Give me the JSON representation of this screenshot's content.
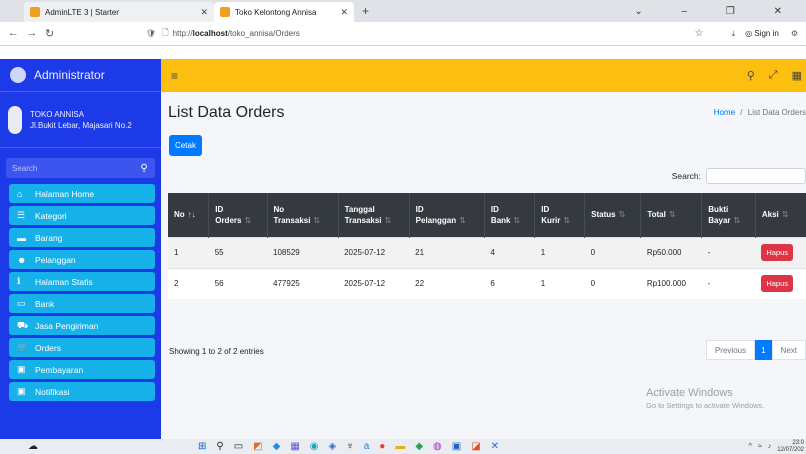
{
  "browser": {
    "tabs": [
      {
        "title": "AdminLTE 3 | Starter"
      },
      {
        "title": "Toko Kelontong Annisa"
      }
    ],
    "url_prefix": "http://",
    "url_host": "localhost",
    "url_path": "/toko_annisa/Orders",
    "sign_in": "Sign in"
  },
  "sidebar": {
    "brand": "Administrator",
    "store_name": "TOKO ANNISA",
    "store_address": "Jl.Bukit Lebar, Majasari No.2",
    "search_placeholder": "Search",
    "items": [
      {
        "label": "Halaman Home",
        "icon": "home-icon",
        "glyph": "⌂"
      },
      {
        "label": "Kategori",
        "icon": "list-icon",
        "glyph": "☰"
      },
      {
        "label": "Barang",
        "icon": "box-icon",
        "glyph": "▬"
      },
      {
        "label": "Pelanggan",
        "icon": "users-icon",
        "glyph": "☻"
      },
      {
        "label": "Halaman Statis",
        "icon": "info-icon",
        "glyph": "ℹ"
      },
      {
        "label": "Bank",
        "icon": "bank-card-icon",
        "glyph": "▭"
      },
      {
        "label": "Jasa Pengiriman",
        "icon": "truck-icon",
        "glyph": "⛟"
      },
      {
        "label": "Orders",
        "icon": "cart-icon",
        "glyph": "🛒"
      },
      {
        "label": "Pembayaran",
        "icon": "money-icon",
        "glyph": "▣"
      },
      {
        "label": "Notifikasi",
        "icon": "bell-icon",
        "glyph": "▣"
      }
    ]
  },
  "page": {
    "title": "List Data Orders",
    "breadcrumb_home": "Home",
    "breadcrumb_sep": "/",
    "breadcrumb_current": "List Data Orders",
    "cetak_label": "Cetak",
    "search_label": "Search:"
  },
  "table": {
    "headers": [
      [
        "No",
        ""
      ],
      [
        "ID",
        "Orders"
      ],
      [
        "No",
        "Transaksi"
      ],
      [
        "Tanggal",
        "Transaksi"
      ],
      [
        "ID",
        "Pelanggan"
      ],
      [
        "ID",
        "Bank"
      ],
      [
        "ID",
        "Kurir"
      ],
      [
        "Status",
        ""
      ],
      [
        "Total",
        ""
      ],
      [
        "Bukti",
        "Bayar"
      ],
      [
        "Aksi",
        ""
      ]
    ],
    "rows": [
      [
        "1",
        "55",
        "108529",
        "2025-07-12",
        "21",
        "4",
        "1",
        "0",
        "Rp50.000",
        "-",
        "Hapus"
      ],
      [
        "2",
        "56",
        "477925",
        "2025-07-12",
        "22",
        "6",
        "1",
        "0",
        "Rp100.000",
        "-",
        "Hapus"
      ]
    ],
    "info": "Showing 1 to 2 of 2 entries",
    "pager": {
      "previous": "Previous",
      "current": "1",
      "next": "Next"
    }
  },
  "watermark": {
    "title": "Activate Windows",
    "subtitle": "Go to Settings to activate Windows."
  },
  "taskbar": {
    "time": "23:0",
    "date": "12/07/202"
  },
  "colors": {
    "sidebar": "#1d3ae8",
    "menu_item": "#16b1e8",
    "topnav": "#fcbf0f",
    "primary": "#007bff",
    "danger": "#dc3545",
    "table_header": "#343a40"
  }
}
